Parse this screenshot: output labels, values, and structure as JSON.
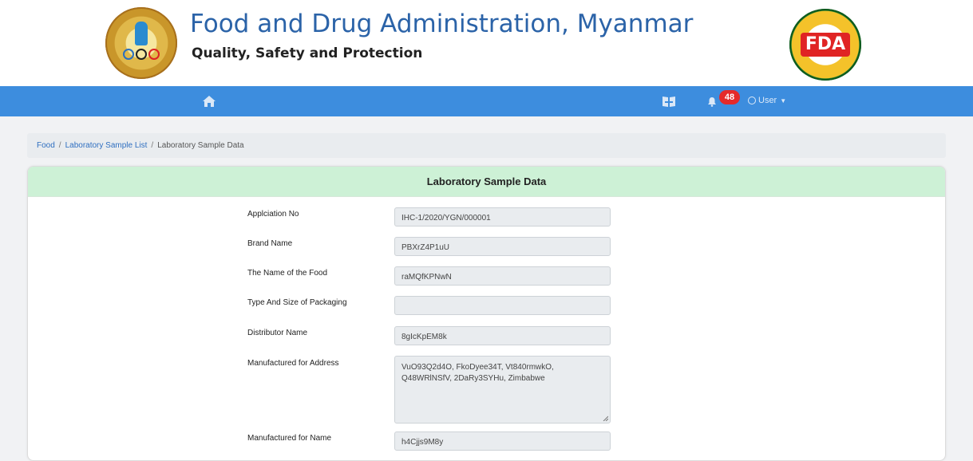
{
  "header": {
    "title": "Food and Drug Administration, Myanmar",
    "subtitle": "Quality, Safety and Protection",
    "left_logo": "ministry-of-health-and-sports-seal",
    "right_logo": "fda-seal",
    "right_logo_text": "FDA"
  },
  "navbar": {
    "home_icon": "home-icon",
    "book_icon": "book-icon",
    "bell_icon": "bell-icon",
    "notification_count": "48",
    "user_label": "User",
    "colors": {
      "bar": "#3d8dde",
      "badge": "#e52a2a"
    }
  },
  "breadcrumb": {
    "items": [
      "Food",
      "Laboratory Sample List",
      "Laboratory Sample Data"
    ]
  },
  "card": {
    "title": "Laboratory Sample Data",
    "header_color": "#cdf1d6",
    "fields": [
      {
        "label": "Applciation No",
        "value": "IHC-1/2020/YGN/000001"
      },
      {
        "label": "Brand Name",
        "value": "PBXrZ4P1uU"
      },
      {
        "label": "The Name of the Food",
        "value": "raMQfKPNwN"
      },
      {
        "label": "Type And Size of Packaging",
        "value": ""
      },
      {
        "label": "Distributor Name",
        "value": "8gIcKpEM8k"
      },
      {
        "label": "Manufactured for Address",
        "value": "VuO93Q2d4O, FkoDyee34T, Vt840rmwkO, Q48WRlNSfV, 2DaRy3SYHu, Zimbabwe"
      },
      {
        "label": "Manufactured for Name",
        "value": "h4Cjjs9M8y"
      }
    ]
  }
}
